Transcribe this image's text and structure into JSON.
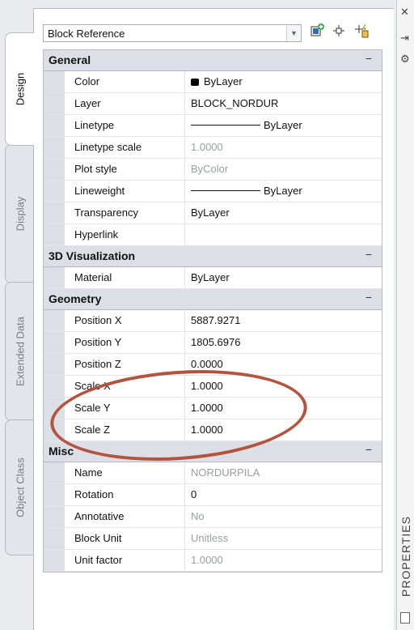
{
  "window": {
    "close_glyph": "✕",
    "autohide_glyph": "⇥",
    "settings_glyph": "⚙",
    "title": "PROPERTIES"
  },
  "tabs": [
    {
      "label": "Design",
      "active": true
    },
    {
      "label": "Display",
      "active": false
    },
    {
      "label": "Extended Data",
      "active": false
    },
    {
      "label": "Object Class",
      "active": false
    }
  ],
  "selector": {
    "value": "Block Reference"
  },
  "toolbar": {
    "add_selected_icon": "add-selected-object-icon",
    "select_objects_icon": "select-objects-icon",
    "quick_select_icon": "quick-select-icon"
  },
  "categories": [
    {
      "title": "General",
      "collapse": "−",
      "rows": [
        {
          "name": "Color",
          "value": "ByLayer",
          "dim": false,
          "swatch": true
        },
        {
          "name": "Layer",
          "value": "BLOCK_NORDUR",
          "dim": false
        },
        {
          "name": "Linetype",
          "value": "ByLayer",
          "dim": false,
          "line": true
        },
        {
          "name": "Linetype scale",
          "value": "1.0000",
          "dim": true
        },
        {
          "name": "Plot style",
          "value": "ByColor",
          "dim": true
        },
        {
          "name": "Lineweight",
          "value": "ByLayer",
          "dim": false,
          "line": true
        },
        {
          "name": "Transparency",
          "value": "ByLayer",
          "dim": false
        },
        {
          "name": "Hyperlink",
          "value": "",
          "dim": false
        }
      ]
    },
    {
      "title": "3D Visualization",
      "collapse": "−",
      "rows": [
        {
          "name": "Material",
          "value": "ByLayer",
          "dim": false
        }
      ]
    },
    {
      "title": "Geometry",
      "collapse": "−",
      "rows": [
        {
          "name": "Position X",
          "value": "5887.9271",
          "dim": false
        },
        {
          "name": "Position Y",
          "value": "1805.6976",
          "dim": false
        },
        {
          "name": "Position Z",
          "value": "0.0000",
          "dim": false
        },
        {
          "name": "Scale X",
          "value": "1.0000",
          "dim": false
        },
        {
          "name": "Scale Y",
          "value": "1.0000",
          "dim": false
        },
        {
          "name": "Scale Z",
          "value": "1.0000",
          "dim": false
        }
      ]
    },
    {
      "title": "Misc",
      "collapse": "−",
      "rows": [
        {
          "name": "Name",
          "value": "NORDURPILA",
          "dim": true
        },
        {
          "name": "Rotation",
          "value": "0",
          "dim": false
        },
        {
          "name": "Annotative",
          "value": "No",
          "dim": true
        },
        {
          "name": "Block Unit",
          "value": "Unitless",
          "dim": true
        },
        {
          "name": "Unit factor",
          "value": "1.0000",
          "dim": true
        }
      ]
    }
  ],
  "colors": {
    "highlight": "#b5543e",
    "category_bg": "#dcdfe5"
  }
}
